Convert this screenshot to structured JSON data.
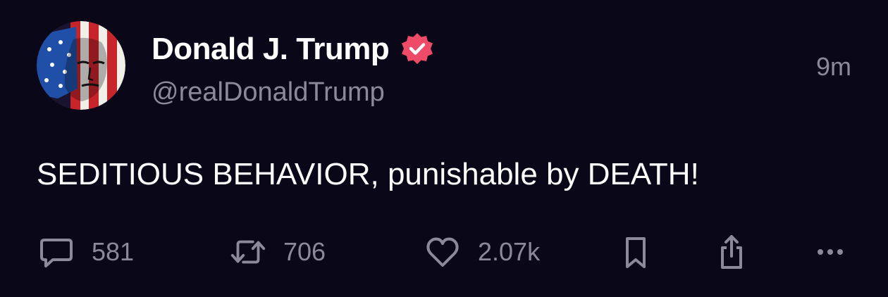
{
  "post": {
    "author": {
      "display_name": "Donald J. Trump",
      "handle": "@realDonaldTrump",
      "verified": true,
      "verified_icon": "verified-badge-icon",
      "avatar_icon": "profile-avatar-flag-face"
    },
    "timestamp": "9m",
    "text": "SEDITIOUS BEHAVIOR, punishable by DEATH!"
  },
  "actions": {
    "reply": {
      "icon": "speech-bubble-icon",
      "count": "581"
    },
    "repost": {
      "icon": "repost-arrows-icon",
      "count": "706"
    },
    "like": {
      "icon": "heart-icon",
      "count": "2.07k"
    },
    "bookmark": {
      "icon": "bookmark-icon"
    },
    "share": {
      "icon": "share-upload-icon"
    },
    "more": {
      "icon": "ellipsis-icon"
    }
  },
  "colors": {
    "background": "#0a0718",
    "primary_text": "#ffffff",
    "secondary_text": "#8c8a99",
    "verified_badge": "#ee4b68",
    "flag_red": "#c8242b",
    "flag_blue": "#1f4fa6"
  }
}
